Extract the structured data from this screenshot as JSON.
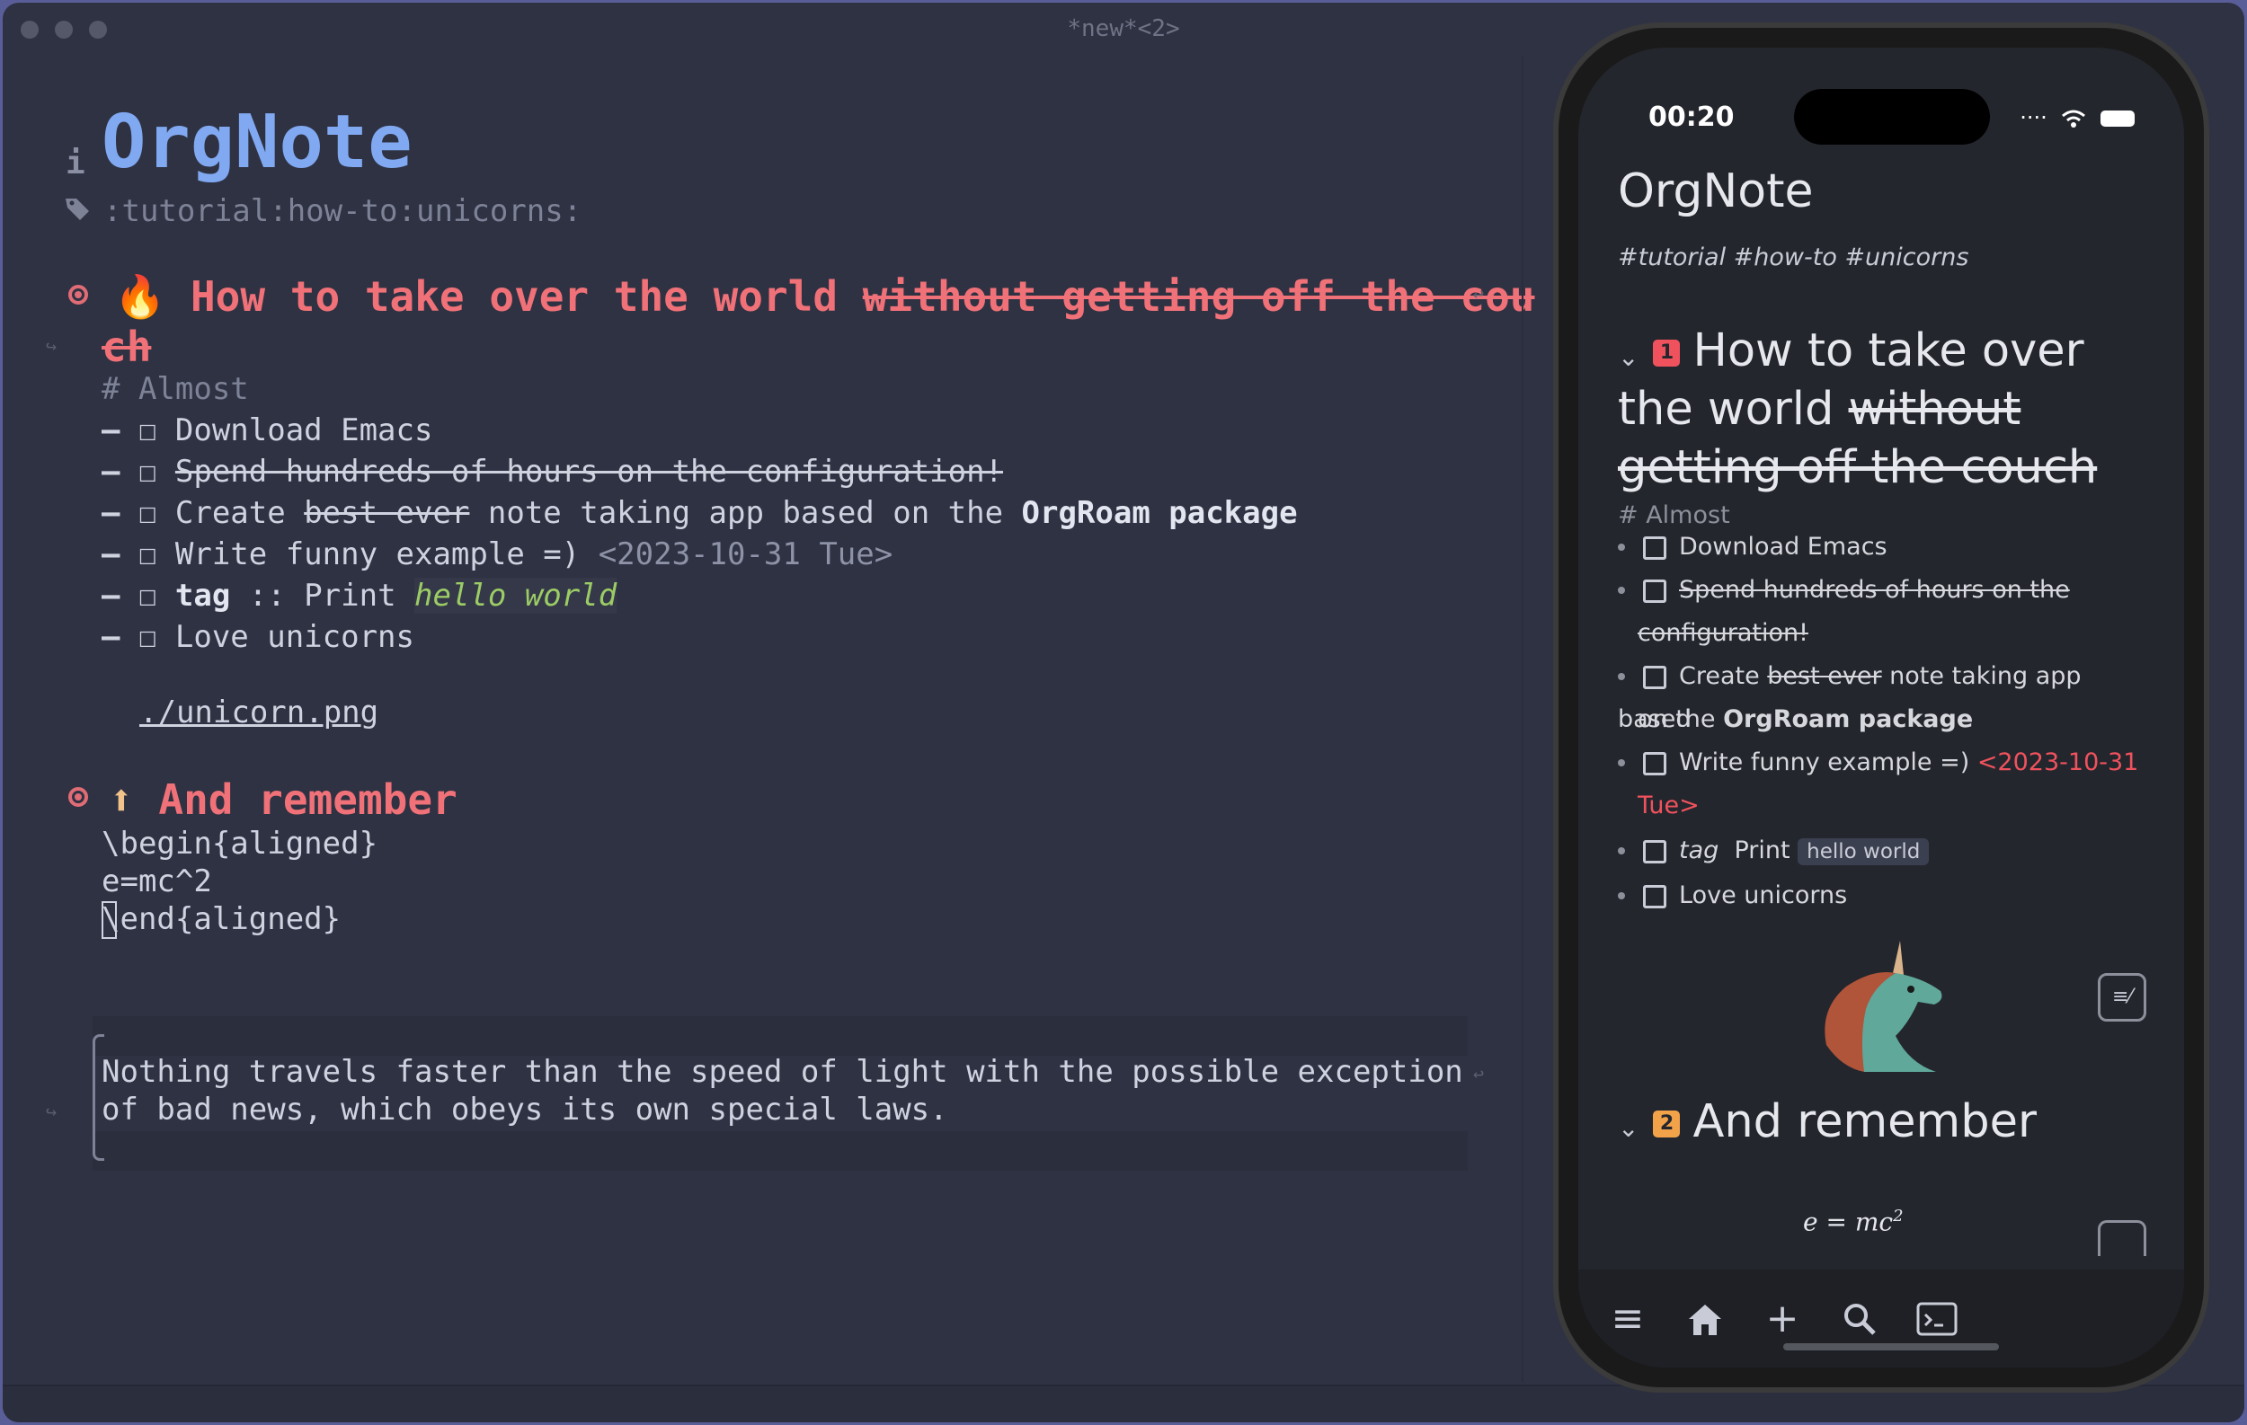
{
  "window": {
    "title": "*new*<2>"
  },
  "editor": {
    "title": "OrgNote",
    "filetags": ":tutorial:how-to:unicorns:",
    "heading1": {
      "emoji": "🔥",
      "text": "How to take over the world ",
      "strike_text": "without getting off the cou",
      "wrap": "ch"
    },
    "comment": "# Almost",
    "items": [
      {
        "text": "Download Emacs"
      },
      {
        "strike": "Spend hundreds of hours on the configuration!"
      },
      {
        "pre": "Create ",
        "strike": "best ever",
        "mid": " note taking app based on the ",
        "bold": "OrgRoam package"
      },
      {
        "text": "Write funny example =) ",
        "date": "<2023-10-31 Tue>"
      },
      {
        "tag": "tag",
        "sep": " :: Print ",
        "italic": "hello world"
      },
      {
        "text": "Love unicorns"
      }
    ],
    "link": "./unicorn.png",
    "heading2": {
      "emoji": "⬆",
      "text": "And remember"
    },
    "latex": [
      "\\begin{aligned}",
      "e=mc^2",
      "\\end{aligned}"
    ],
    "quote": [
      "Nothing travels faster than the speed of light with the possible exception",
      "of bad news, which obeys its own special laws."
    ]
  },
  "phone": {
    "time": "00:20",
    "title": "OrgNote",
    "tags": "#tutorial  #how-to  #unicorns",
    "heading1": {
      "badge": "1",
      "line1": "How to take over",
      "line2_pre": "the world ",
      "line2_strike": "without",
      "line3_strike": "getting off the couch"
    },
    "comment": "# Almost",
    "items": {
      "download": "Download Emacs",
      "spend_1": "Spend hundreds of hours on the",
      "spend_2": "configuration!",
      "create_pre": "Create ",
      "create_strike": "best ever",
      "create_post": " note taking app based",
      "create_2_pre": "on the ",
      "create_2_bold": "OrgRoam package",
      "write": "Write funny example =) ",
      "write_date_1": "<2023-10-31",
      "write_date_2": "Tue>",
      "tag": "tag",
      "print": "Print",
      "pill": "hello world",
      "love": "Love unicorns"
    },
    "heading2": {
      "badge": "2",
      "text": "And remember"
    },
    "math": "e = mc",
    "math_exp": "2",
    "colors": {
      "badge1": "#f0525d",
      "badge2": "#f2a34a"
    },
    "nav_icons": [
      "menu-icon",
      "home-icon",
      "plus-icon",
      "search-icon",
      "terminal-icon"
    ]
  }
}
